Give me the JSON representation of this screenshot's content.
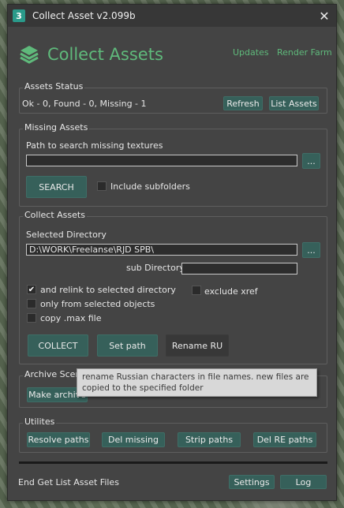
{
  "window": {
    "title": "Collect Asset v2.099b",
    "app_icon": "3",
    "close_glyph": "✕"
  },
  "header": {
    "logo_text": "Collect Assets",
    "link_updates": "Updates",
    "link_render_farm": "Render Farm",
    "accent_color": "#5fb97b"
  },
  "assets_status": {
    "title": "Assets Status",
    "summary": "Ok - 0, Found - 0, Missing - 1",
    "refresh_label": "Refresh",
    "list_assets_label": "List Assets"
  },
  "missing_assets": {
    "title": "Missing Assets",
    "path_label": "Path to search missing textures",
    "path_value": "",
    "browse_label": "...",
    "search_label": "SEARCH",
    "include_subfolders_label": "Include subfolders",
    "include_subfolders_checked": false
  },
  "collect_assets": {
    "title": "Collect Assets",
    "selected_dir_label": "Selected Directory",
    "selected_dir_value": "D:\\WORK\\Freelanse\\RJD SPB\\",
    "browse_label": "...",
    "sub_dir_label": "sub Directory",
    "sub_dir_value": "",
    "relink_label": "and relink to selected directory",
    "relink_checked": true,
    "exclude_xref_label": "exclude xref",
    "exclude_xref_checked": false,
    "selected_objects_label": "only from selected objects",
    "selected_objects_checked": false,
    "copy_max_label": "copy .max file",
    "copy_max_checked": false,
    "collect_label": "COLLECT",
    "set_path_label": "Set path",
    "rename_ru_label": "Rename RU"
  },
  "archive_scene": {
    "title": "Archive Scene",
    "make_archive_label": "Make archive"
  },
  "tooltip": {
    "text": "rename Russian characters in file names. new files are copied to the specified folder"
  },
  "utilites": {
    "title": "Utilites",
    "resolve_paths_label": "Resolve paths",
    "del_missing_label": "Del missing",
    "strip_paths_label": "Strip paths",
    "del_re_paths_label": "Del RE paths"
  },
  "footer": {
    "status_text": "End Get List Asset Files",
    "settings_label": "Settings",
    "log_label": "Log",
    "progress": 1.0
  }
}
